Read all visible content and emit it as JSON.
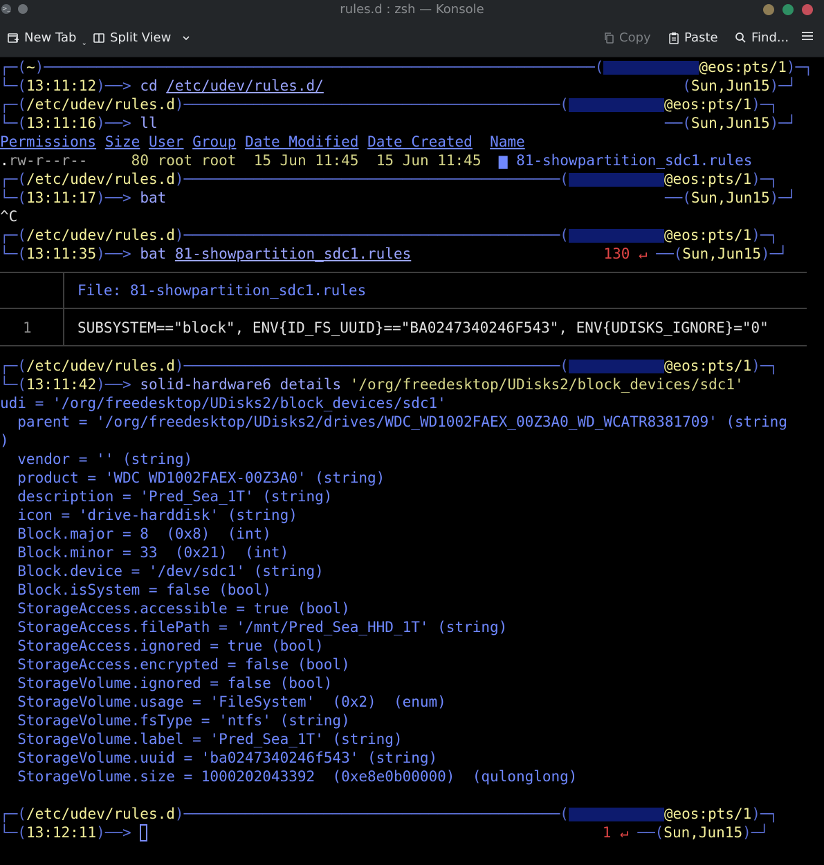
{
  "window": {
    "title": "rules.d : zsh — Konsole",
    "btn_colors": [
      "#8e7d55",
      "#2e8f63",
      "#c44e5a"
    ]
  },
  "toolbar": {
    "new_tab": "New Tab",
    "split_view": "Split View",
    "copy": "Copy",
    "paste": "Paste",
    "find": "Find...",
    "menu_icon": "hamburger-menu-icon"
  },
  "prompts": [
    {
      "dir": "~",
      "time": "13:11:12",
      "cmd": "cd ",
      "arg": "/etc/udev/rules.d/"
    },
    {
      "dir": "/etc/udev/rules.d",
      "time": "13:11:16",
      "cmd": "ll",
      "arg": ""
    },
    {
      "dir": "/etc/udev/rules.d",
      "time": "13:11:17",
      "cmd": "bat",
      "arg": ""
    },
    {
      "dir": "/etc/udev/rules.d",
      "time": "13:11:35",
      "cmd": "bat ",
      "arg": "81-showpartition_sdc1.rules",
      "status": "130 ↵"
    },
    {
      "dir": "/etc/udev/rules.d",
      "time": "13:11:42",
      "cmd": "solid-hardware6 details ",
      "arg": "'/org/freedesktop/UDisks2/block_devices/sdc1'"
    },
    {
      "dir": "/etc/udev/rules.d",
      "time": "13:12:11",
      "cmd": "",
      "arg": "",
      "status": "1 ↵"
    }
  ],
  "host": {
    "at": "@eos:pts/1",
    "date": "Sun,Jun15"
  },
  "ls": {
    "headers": [
      "Permissions",
      "Size",
      "User",
      "Group",
      "Date Modified",
      "Date Created",
      "Name"
    ],
    "row": {
      "type": ".",
      "perms": "rw-r--r--",
      "size": "80",
      "user": "root",
      "group": "root",
      "modified": "15 Jun 11:45",
      "created": "15 Jun 11:45",
      "name": "81-showpartition_sdc1.rules"
    }
  },
  "interrupt": "^C",
  "bat": {
    "file_label": "File: ",
    "file_name": "81-showpartition_sdc1.rules",
    "line_no": "1",
    "line": "SUBSYSTEM==\"block\", ENV{ID_FS_UUID}==\"BA0247340246F543\", ENV{UDISKS_IGNORE}=\"0\""
  },
  "details": {
    "udi": "udi = '/org/freedesktop/UDisks2/block_devices/sdc1'",
    "parent": "  parent = '/org/freedesktop/UDisks2/drives/WDC_WD1002FAEX_00Z3A0_WD_WCATR8381709' (string",
    "parent_cont": ")",
    "lines": [
      "  vendor = '' (string)",
      "  product = 'WDC WD1002FAEX-00Z3A0' (string)",
      "  description = 'Pred_Sea_1T' (string)",
      "  icon = 'drive-harddisk' (string)",
      "  Block.major = 8  (0x8)  (int)",
      "  Block.minor = 33  (0x21)  (int)",
      "  Block.device = '/dev/sdc1' (string)",
      "  Block.isSystem = false (bool)",
      "  StorageAccess.accessible = true (bool)",
      "  StorageAccess.filePath = '/mnt/Pred_Sea_HHD_1T' (string)",
      "  StorageAccess.ignored = true (bool)",
      "  StorageAccess.encrypted = false (bool)",
      "  StorageVolume.ignored = false (bool)",
      "  StorageVolume.usage = 'FileSystem'  (0x2)  (enum)",
      "  StorageVolume.fsType = 'ntfs' (string)",
      "  StorageVolume.label = 'Pred_Sea_1T' (string)",
      "  StorageVolume.uuid = 'ba0247340246f543' (string)",
      "  StorageVolume.size = 1000202043392  (0xe8e0b00000)  (qulonglong)"
    ]
  }
}
